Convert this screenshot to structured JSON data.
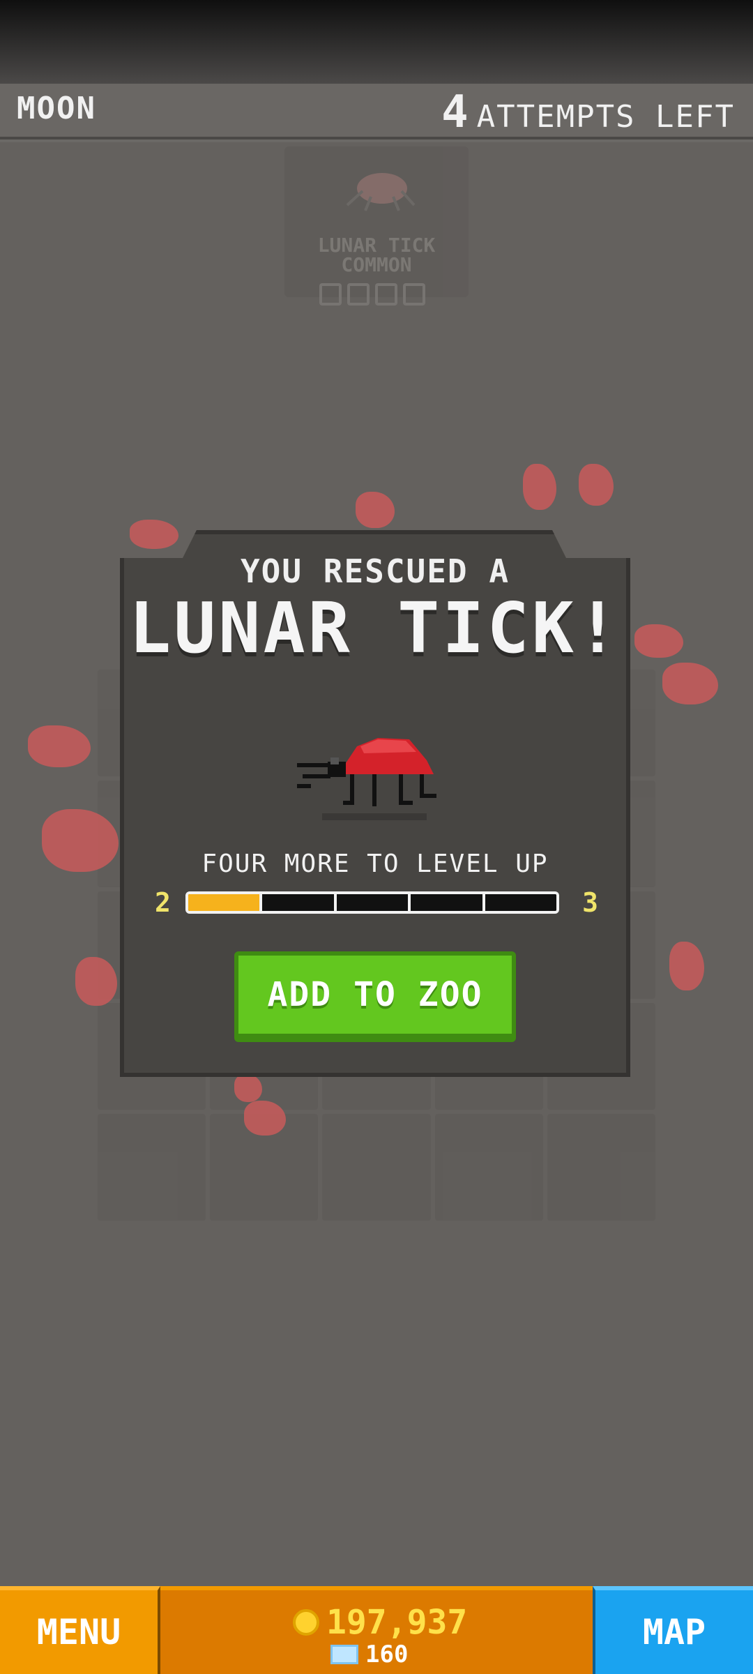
{
  "header": {
    "location": "MOON",
    "attempts_count": "4",
    "attempts_label": "ATTEMPTS LEFT"
  },
  "background_card": {
    "name": "LUNAR TICK",
    "rarity": "COMMON"
  },
  "modal": {
    "headline": "YOU RESCUED A",
    "animal_name": "LUNAR TICK!",
    "level_text": "FOUR MORE TO LEVEL UP",
    "level_from": "2",
    "level_to": "3",
    "progress_filled_segments": 1,
    "progress_total_segments": 5,
    "add_button": "ADD TO ZOO"
  },
  "bottom": {
    "menu_label": "MENU",
    "coins": "197,937",
    "gems": "160",
    "map_label": "MAP"
  },
  "colors": {
    "button_green": "#63c71f",
    "progress_fill": "#f6b21c",
    "menu_orange": "#f29a00",
    "map_blue": "#1aa3f0"
  }
}
